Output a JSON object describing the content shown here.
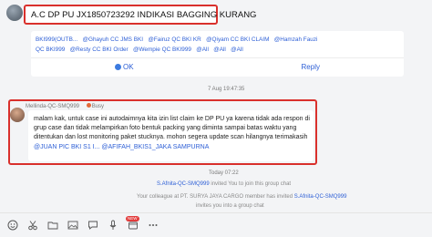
{
  "header": {
    "title": "A.C DP PU JX1850723292 INDIKASI BAGGING KURANG"
  },
  "card": {
    "mentions": [
      "BKI999(OUTB...",
      "@Ghayuh CC JMS BKI",
      "@Fairuz QC BKI KR",
      "@Qiyam CC BKI CLAIM",
      "@Hamzah Fauzi",
      "QC BKI999",
      "@Resty CC BKI Order",
      "@Wempie QC BKI999",
      "@All",
      "@All",
      "@All"
    ],
    "ok_label": "OK",
    "reply_label": "Reply"
  },
  "timestamps": {
    "first": "7 Aug 19:47:35",
    "second": "Today 07:22"
  },
  "message": {
    "sender": "Mellinda-QC-SMQ999",
    "status": "Busy",
    "lines": [
      "malam kak, untuk case ini autodaimnya kita izin list claim ke DP PU ya karena tidak ada respon di",
      "grup case dan tidak melampirkan foto bentuk packing yang diminta sampai batas waktu yang",
      "ditentukan dan lost monitoring paket stucknya. mohon segera update scan hilangnya terimakasih"
    ],
    "tags": "@JUAN PIC BKI S1 I...   @AFIFAH_BKIS1_JAKA SAMPURNA"
  },
  "system": {
    "invite1_name": "S.Afnita-QC-SMQ999",
    "invite1_text": " invited You to join this group chat",
    "invite2_prefix": "Your colleague at PT. SURYA JAYA CARGO member has invited",
    "invite2_name": " S.Afnita-QC-SMQ999",
    "invite2_suffix": "invites you into a group chat"
  },
  "toolbar": {
    "icons": [
      "emoji-icon",
      "scissors-icon",
      "folder-icon",
      "image-icon",
      "chat-history-icon",
      "new-feature-icon",
      "more-icon"
    ],
    "badge": "NEW"
  }
}
